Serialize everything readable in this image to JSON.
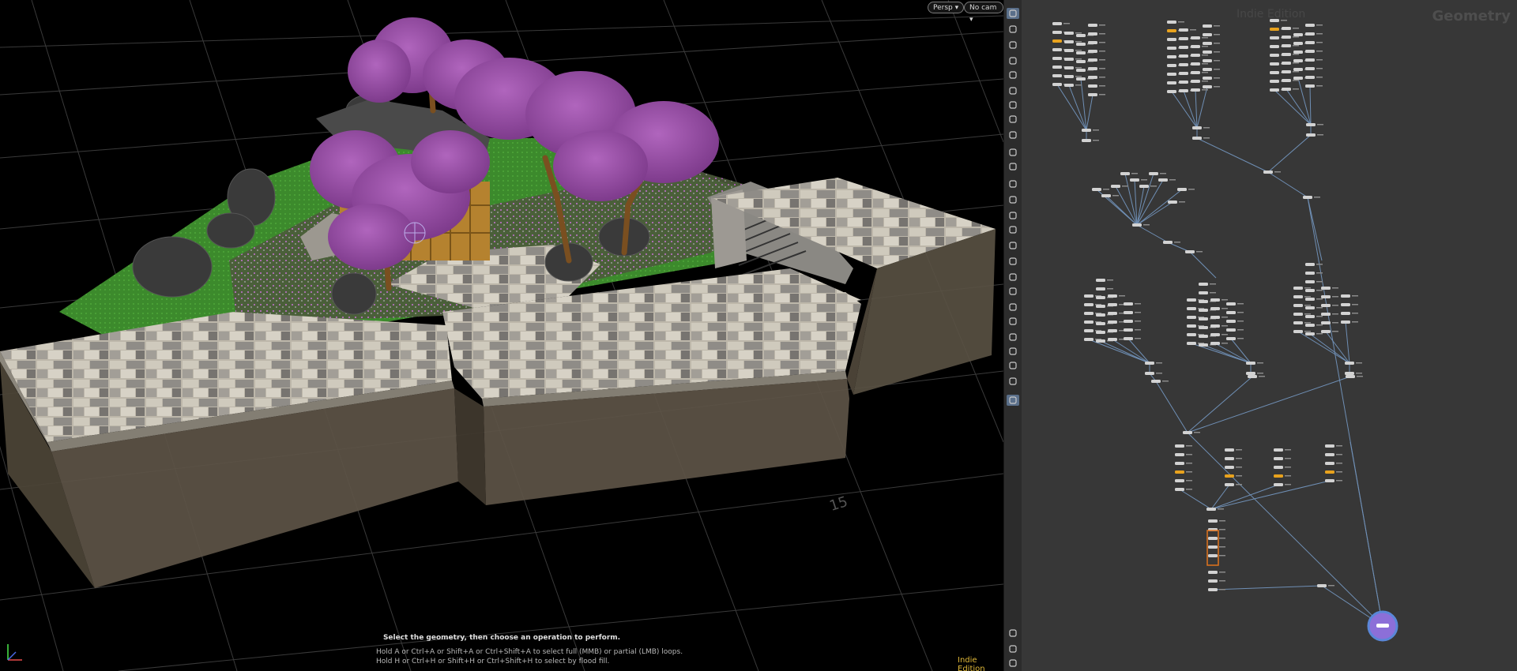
{
  "viewport": {
    "persp_menu": "Persp ▾",
    "camera_menu": "No cam ▾",
    "instruction": "Select the geometry, then choose an operation to perform.",
    "hint_line1": "Hold A or Ctrl+A or Shift+A or Ctrl+Shift+A to select full (MMB) or partial (LMB) loops.",
    "hint_line2": "Hold H or Ctrl+H or Shift+H or Ctrl+Shift+H to select by flood fill.",
    "edition_label": "Indie Edition",
    "grid_number": "15"
  },
  "network": {
    "edition_watermark": "Indie Edition",
    "context_label": "Geometry"
  },
  "toolbar": {
    "icons": [
      "select-arrow-icon",
      "view-icon",
      "lock-icon",
      "handle-icon",
      "display-options-icon",
      "light-icon",
      "light-icon",
      "headlight-icon",
      "camera-icon",
      "snap-icon",
      "pivot-icon",
      "point-icon",
      "brush-icon",
      "pen-icon",
      "number-icon",
      "box-icon",
      "ruler-icon",
      "corner-icon",
      "shelf-icon",
      "box-icon",
      "shape-icon",
      "texture-icon",
      "pivot-icon",
      "grid-icon",
      "camera-view-icon",
      "pin-icon",
      "info-icon",
      "layout-icon",
      "screenshot-icon"
    ]
  },
  "colors": {
    "grass": "#3f8a2e",
    "blossom": "#9a4fa8",
    "stone": "#b9b3a6",
    "wall": "#5d5446",
    "node": "#d2d2d2",
    "flag": "#e8a21d",
    "wire": "#6f8fb5",
    "output": "#8c6fd8"
  }
}
